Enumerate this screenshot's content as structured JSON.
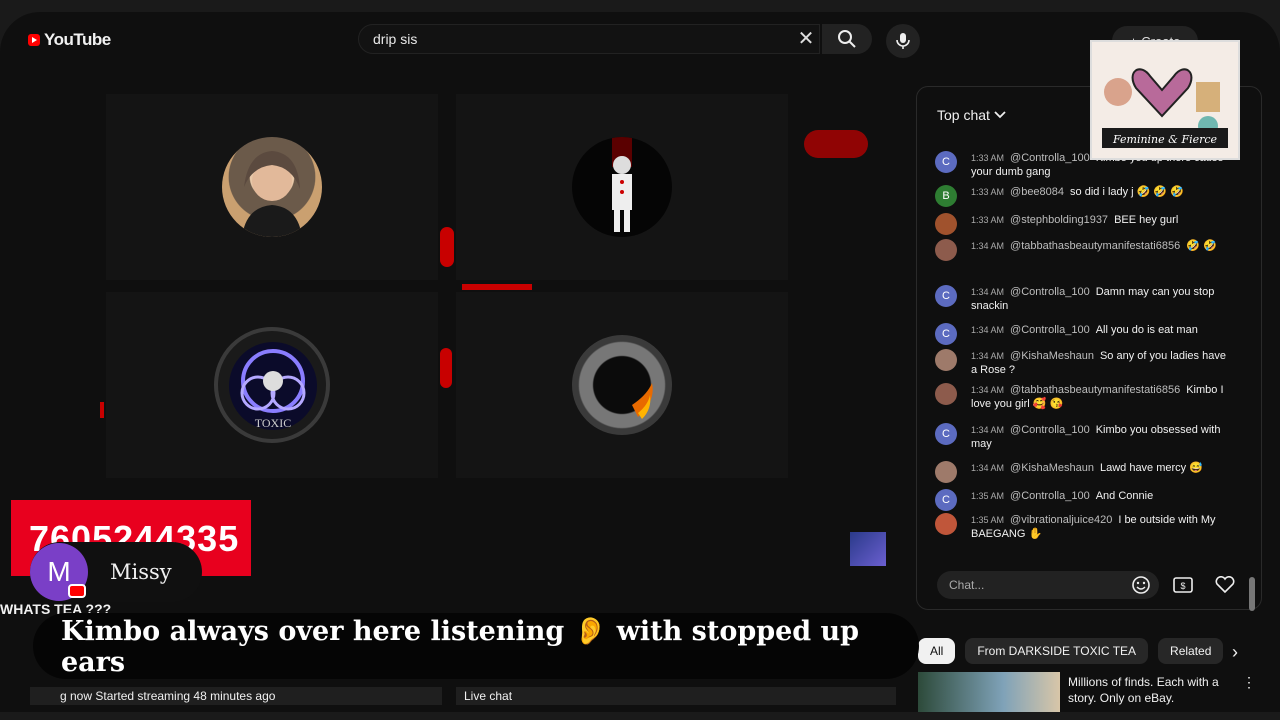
{
  "header": {
    "logo_text": "YouTube",
    "search_value": "drip sis",
    "create_label": "Create"
  },
  "sticker": {
    "brand_text": "Feminine & Fierce"
  },
  "stream": {
    "phone_number": "7605244335",
    "presenter_name": "Missy",
    "presenter_initial": "M",
    "segment_title": "WHATS TEA ???",
    "caption": "Kimbo always over here listening 👂 with stopped up ears",
    "status_left": "g now  Started streaming 48 minutes ago",
    "status_right": "Live chat"
  },
  "chat": {
    "header_label": "Top chat",
    "input_placeholder": "Chat...",
    "messages": [
      {
        "initial": "C",
        "color": "#5c6bc0",
        "time": "1:33 AM",
        "author": "@Controlla_100",
        "text": "Kimbo you up there cause your dumb gang"
      },
      {
        "initial": "B",
        "color": "#2e7d32",
        "time": "1:33 AM",
        "author": "@bee8084",
        "text": "so did i lady j 🤣 🤣 🤣"
      },
      {
        "initial": "",
        "color": "#a0522d",
        "time": "1:33 AM",
        "author": "@stephbolding1937",
        "text": "BEE hey gurl"
      },
      {
        "initial": "",
        "color": "#8d5b4c",
        "time": "1:34 AM",
        "author": "@tabbathasbeautymanifestati6856",
        "text": "🤣 🤣"
      },
      {
        "initial": "C",
        "color": "#5c6bc0",
        "time": "1:34 AM",
        "author": "@Controlla_100",
        "text": "Damn may can you stop snackin"
      },
      {
        "initial": "C",
        "color": "#5c6bc0",
        "time": "1:34 AM",
        "author": "@Controlla_100",
        "text": "All you do is eat man"
      },
      {
        "initial": "",
        "color": "#9e7a6a",
        "time": "1:34 AM",
        "author": "@KishaMeshaun",
        "text": "So any of you ladies have a Rose ?"
      },
      {
        "initial": "",
        "color": "#8d5b4c",
        "time": "1:34 AM",
        "author": "@tabbathasbeautymanifestati6856",
        "text": "Kimbo I love you girl 🥰 😘"
      },
      {
        "initial": "C",
        "color": "#5c6bc0",
        "time": "1:34 AM",
        "author": "@Controlla_100",
        "text": "Kimbo you obsessed with may"
      },
      {
        "initial": "",
        "color": "#9e7a6a",
        "time": "1:34 AM",
        "author": "@KishaMeshaun",
        "text": "Lawd have mercy 😅"
      },
      {
        "initial": "C",
        "color": "#5c6bc0",
        "time": "1:35 AM",
        "author": "@Controlla_100",
        "text": "And Connie"
      },
      {
        "initial": "",
        "color": "#c0563a",
        "time": "1:35 AM",
        "author": "@vibrationaljuice420",
        "text": "I be outside with My BAEGANG ✋"
      }
    ]
  },
  "chips": [
    "All",
    "From DARKSIDE TOXIC TEA",
    "Related"
  ],
  "recommendation": {
    "title": "Millions of finds. Each with a story. Only on eBay."
  }
}
